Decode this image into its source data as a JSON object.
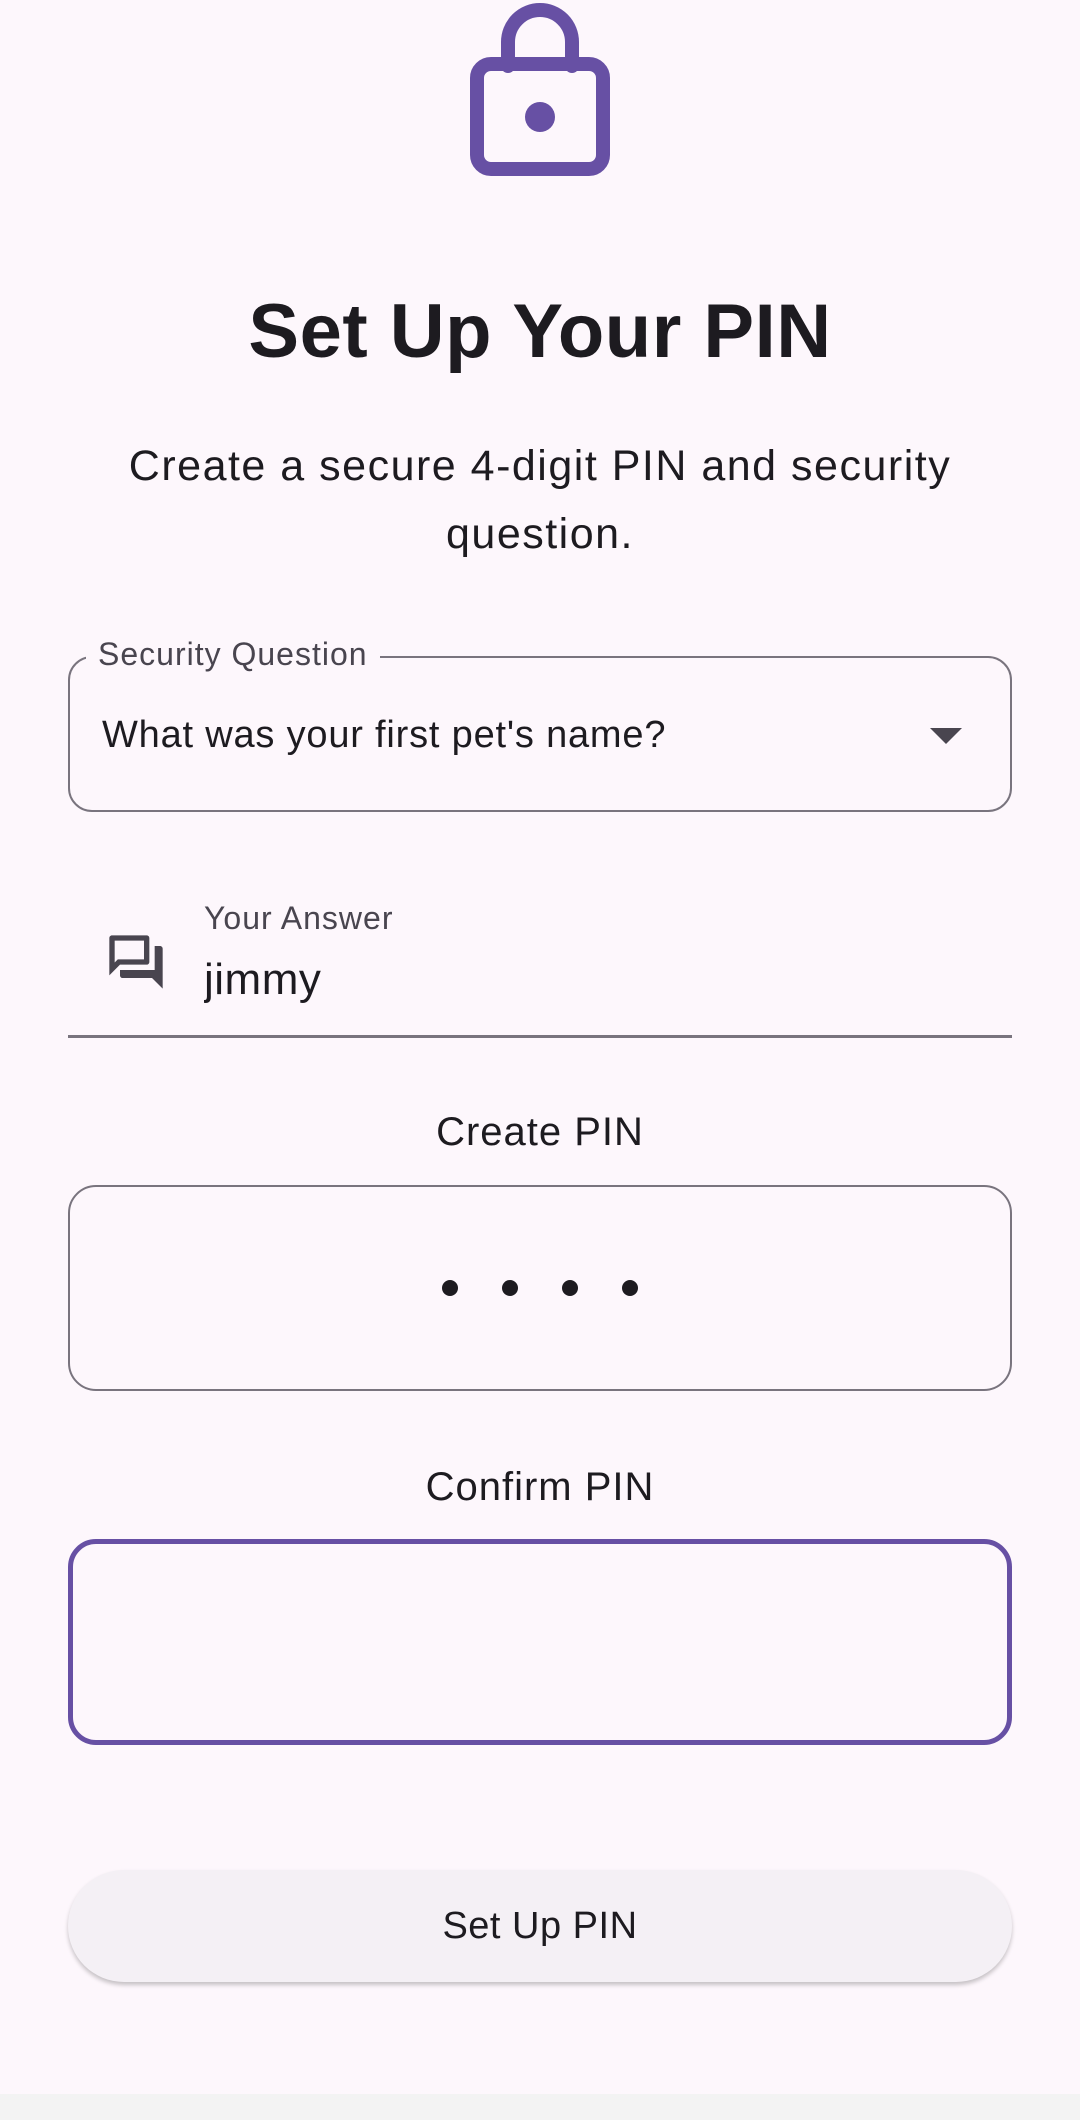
{
  "header": {
    "icon": "lock-icon",
    "title": "Set Up Your PIN",
    "subtitle": "Create a secure 4-digit PIN and security question."
  },
  "security_question": {
    "label": "Security Question",
    "selected": "What was your first pet's name?",
    "icon": "arrow-drop-down-icon"
  },
  "answer": {
    "icon": "forum-icon",
    "label": "Your Answer",
    "value": "jimmy"
  },
  "create_pin": {
    "label": "Create PIN",
    "masked_value": "••••",
    "digits_entered": 4
  },
  "confirm_pin": {
    "label": "Confirm PIN",
    "value": ""
  },
  "submit": {
    "label": "Set Up PIN"
  },
  "colors": {
    "accent": "#6750a4",
    "background": "#fdf7fc",
    "outline": "#79747e",
    "text": "#1d1b20"
  }
}
